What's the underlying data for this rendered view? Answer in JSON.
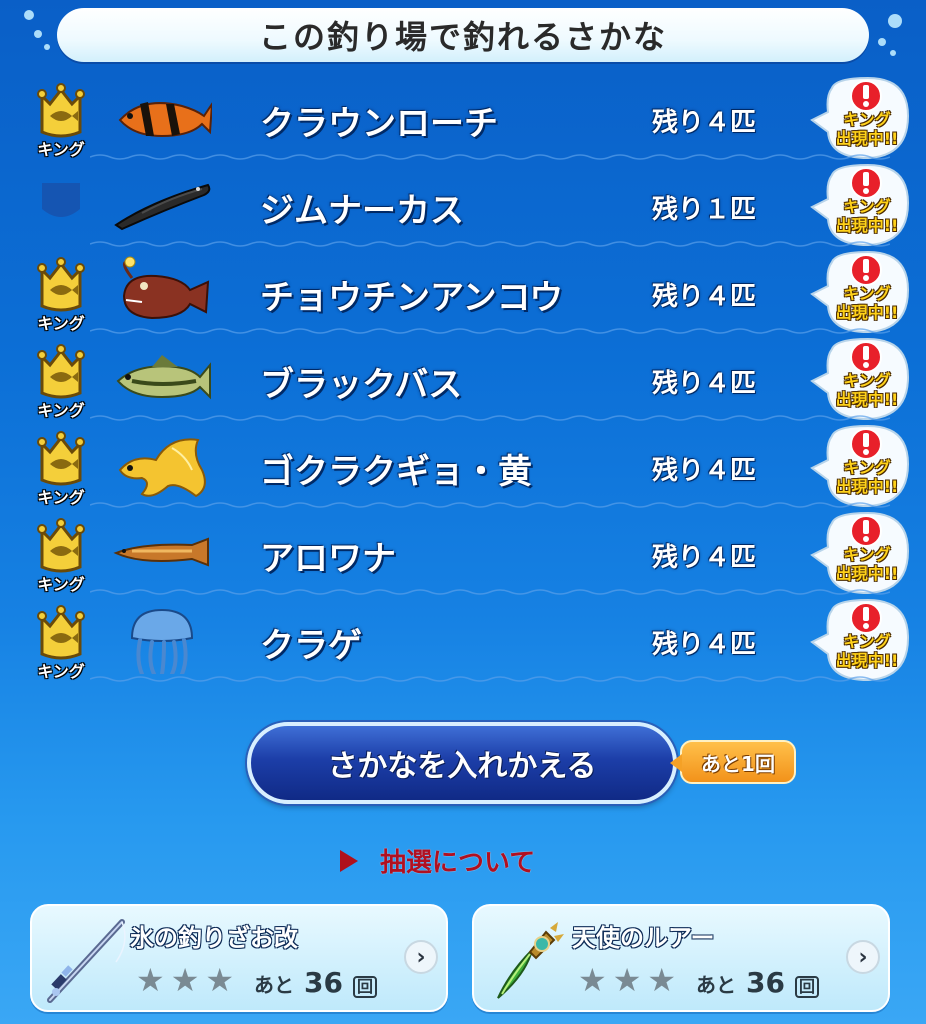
{
  "title": "この釣り場で釣れるさかな",
  "fish": [
    {
      "name": "クラウンローチ",
      "remaining": "残り４匹",
      "badge": "king",
      "badge_label": "キング",
      "icon": "clown-loach-icon",
      "alert": "キング\n出現中!!"
    },
    {
      "name": "ジムナーカス",
      "remaining": "残り１匹",
      "badge": "empty",
      "badge_label": "",
      "icon": "gymnarchus-icon",
      "alert": "キング\n出現中!!"
    },
    {
      "name": "チョウチンアンコウ",
      "remaining": "残り４匹",
      "badge": "king",
      "badge_label": "キング",
      "icon": "anglerfish-icon",
      "alert": "キング\n出現中!!"
    },
    {
      "name": "ブラックバス",
      "remaining": "残り４匹",
      "badge": "king",
      "badge_label": "キング",
      "icon": "black-bass-icon",
      "alert": "キング\n出現中!!"
    },
    {
      "name": "ゴクラクギョ・黄",
      "remaining": "残り４匹",
      "badge": "king",
      "badge_label": "キング",
      "icon": "betta-yellow-icon",
      "alert": "キング\n出現中!!"
    },
    {
      "name": "アロワナ",
      "remaining": "残り４匹",
      "badge": "king",
      "badge_label": "キング",
      "icon": "arowana-icon",
      "alert": "キング\n出現中!!"
    },
    {
      "name": "クラゲ",
      "remaining": "残り４匹",
      "badge": "king",
      "badge_label": "キング",
      "icon": "jellyfish-icon",
      "alert": "キング\n出現中!!"
    }
  ],
  "swap_button": {
    "label": "さかなを入れかえる",
    "remaining": "あと1回"
  },
  "lottery_link": "抽選について",
  "equipment": [
    {
      "name": "氷の釣りざお改",
      "icon": "ice-fishing-rod-icon",
      "stars": 3,
      "remain_prefix": "あと",
      "remain_count": "36",
      "remain_unit": "回"
    },
    {
      "name": "天使のルアー",
      "icon": "angel-lure-icon",
      "stars": 3,
      "remain_prefix": "あと",
      "remain_count": "36",
      "remain_unit": "回"
    }
  ],
  "colors": {
    "background": "#0c6fd6",
    "title_bg": "#eefaff",
    "button": "#1c3ea8",
    "badge_orange": "#f2921a",
    "link_red": "#b01021",
    "crown_gold": "#f4cf3a",
    "alert_gold": "#ffd21a"
  }
}
